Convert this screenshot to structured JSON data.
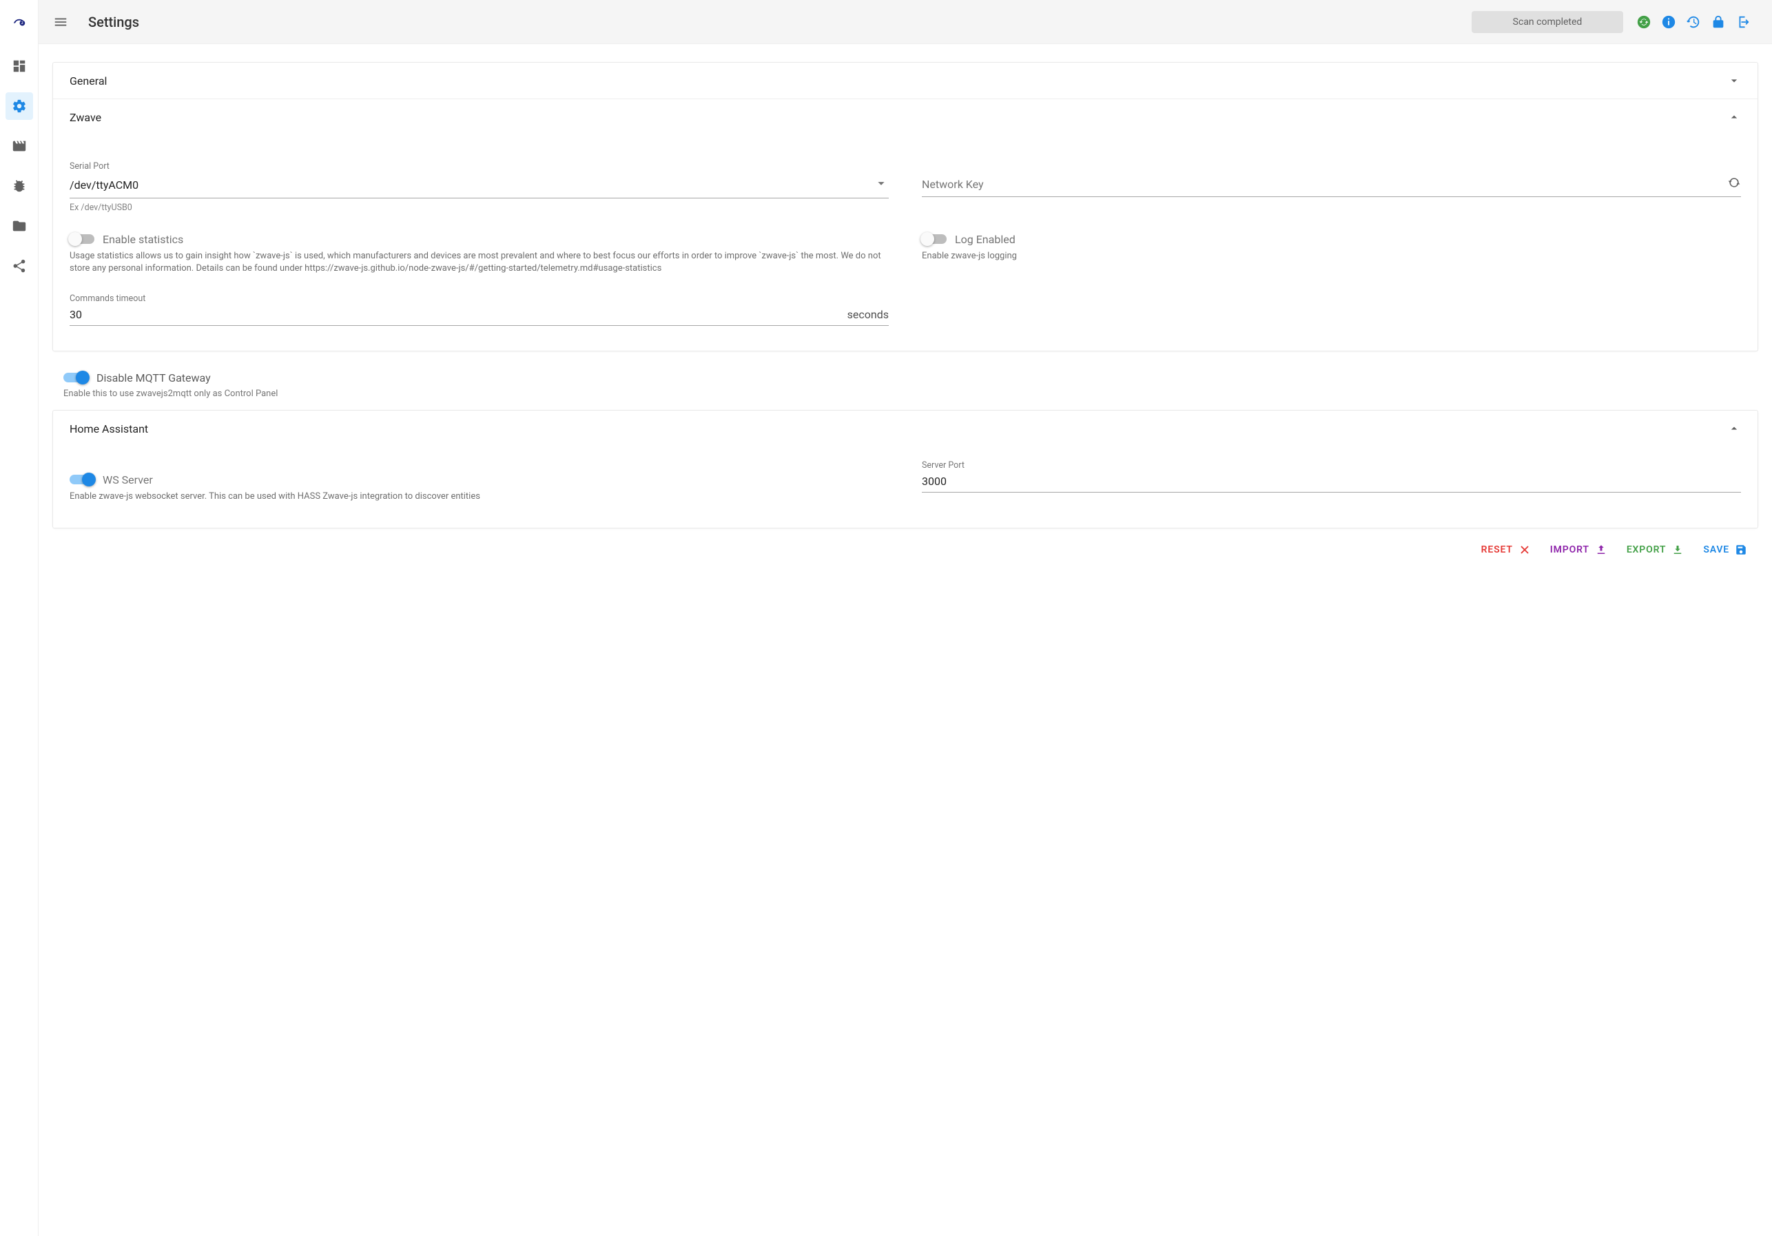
{
  "header": {
    "title": "Settings",
    "scan_status": "Scan completed"
  },
  "panels": {
    "general": {
      "title": "General"
    },
    "zwave": {
      "title": "Zwave",
      "serial_port": {
        "label": "Serial Port",
        "value": "/dev/ttyACM0",
        "hint": "Ex /dev/ttyUSB0"
      },
      "network_key": {
        "label": "Network Key",
        "value": ""
      },
      "enable_stats": {
        "label": "Enable statistics",
        "desc": "Usage statistics allows us to gain insight how `zwave-js` is used, which manufacturers and devices are most prevalent and where to best focus our efforts in order to improve `zwave-js` the most. We do not store any personal information. Details can be found under https://zwave-js.github.io/node-zwave-js/#/getting-started/telemetry.md#usage-statistics"
      },
      "log_enabled": {
        "label": "Log Enabled",
        "desc": "Enable zwave-js logging"
      },
      "commands_timeout": {
        "label": "Commands timeout",
        "value": "30",
        "suffix": "seconds"
      }
    },
    "disable_mqtt": {
      "label": "Disable MQTT Gateway",
      "desc": "Enable this to use zwavejs2mqtt only as Control Panel"
    },
    "home_assistant": {
      "title": "Home Assistant",
      "ws_server": {
        "label": "WS Server",
        "desc": "Enable zwave-js websocket server. This can be used with HASS Zwave-js integration to discover entities"
      },
      "server_port": {
        "label": "Server Port",
        "value": "3000"
      }
    }
  },
  "actions": {
    "reset": "Reset",
    "import": "Import",
    "export": "Export",
    "save": "Save"
  }
}
